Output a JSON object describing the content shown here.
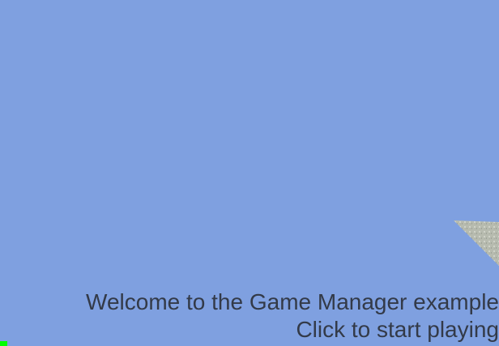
{
  "game": {
    "welcome_text": "Welcome to the Game Manager example",
    "prompt_text": "Click to start playing"
  },
  "colors": {
    "sky": "#7fa0e0",
    "text": "#333a48",
    "indicator": "#00ff00",
    "terrain": "#b8bcb0"
  },
  "icons": {
    "terrain": "rocky-terrain-surface",
    "indicator": "green-status-square"
  }
}
